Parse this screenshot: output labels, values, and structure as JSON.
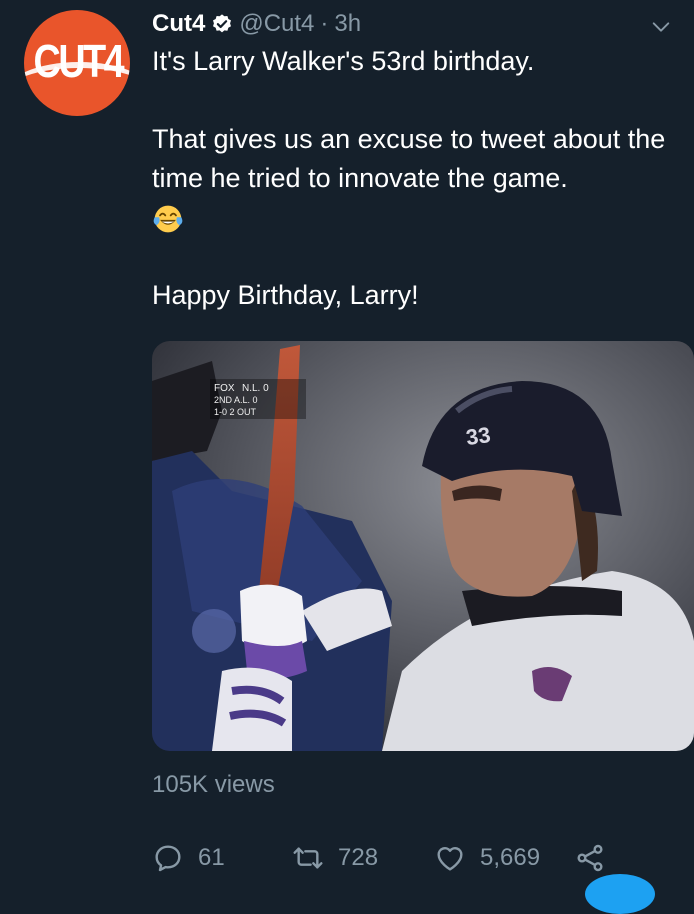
{
  "account": {
    "avatar_text": "CUT4",
    "name": "Cut4",
    "handle": "@Cut4",
    "separator": "·",
    "time": "3h"
  },
  "tweet": {
    "line1": "It's Larry Walker's 53rd birthday.",
    "line2": "That gives us an excuse to tweet about the time he tried to innovate the game.",
    "emoji_name": "tears-of-joy-emoji",
    "line3": "Happy Birthday, Larry!"
  },
  "media": {
    "scorebug": {
      "network": "FOX",
      "row1": "N.L.  0",
      "row2": "2ND  A.L.  0",
      "row3": "1-0  2 OUT"
    },
    "helmet_number": "33"
  },
  "stats": {
    "views": "105K views",
    "replies": "61",
    "retweets": "728",
    "likes": "5,669"
  },
  "colors": {
    "background": "#15202b",
    "text": "#ffffff",
    "muted": "#8899a6",
    "accent": "#1da1f2",
    "avatar": "#e9552b"
  },
  "icons": [
    "verified-badge-icon",
    "chevron-down-icon",
    "reply-icon",
    "retweet-icon",
    "like-icon",
    "share-icon"
  ]
}
